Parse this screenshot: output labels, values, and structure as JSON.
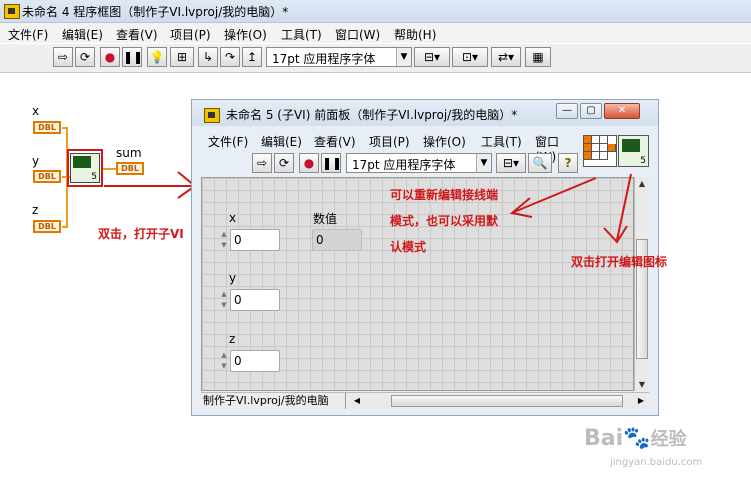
{
  "main_window": {
    "title": "未命名 4 程序框图（制作子VI.lvproj/我的电脑）*",
    "menu": [
      "文件(F)",
      "编辑(E)",
      "查看(V)",
      "项目(P)",
      "操作(O)",
      "工具(T)",
      "窗口(W)",
      "帮助(H)"
    ],
    "toolbar": {
      "font": "17pt 应用程序字体",
      "run_icon": "run-arrow-icon",
      "run_continuous_icon": "run-continuous-icon",
      "abort_icon": "abort-icon",
      "pause_icon": "pause-icon",
      "highlight_icon": "lightbulb-icon",
      "retain_icon": "retain-wire-values-icon",
      "step_into_icon": "step-into-icon",
      "step_over_icon": "step-over-icon",
      "step_out_icon": "step-out-icon",
      "align_icon": "align-objects-icon",
      "distribute_icon": "distribute-objects-icon",
      "reorder_icon": "reorder-icon",
      "cleanup_icon": "clean-up-diagram-icon"
    }
  },
  "diagram": {
    "terminals": [
      {
        "label": "x",
        "type": "DBL"
      },
      {
        "label": "y",
        "type": "DBL"
      },
      {
        "label": "z",
        "type": "DBL"
      }
    ],
    "output": {
      "label": "sum",
      "type": "DBL"
    },
    "subvi_number": "5",
    "annotation_double_click": "双击，打开子VI"
  },
  "sub_window": {
    "title": "未命名 5 (子VI) 前面板（制作子VI.lvproj/我的电脑）*",
    "menu": [
      "文件(F)",
      "编辑(E)",
      "查看(V)",
      "项目(P)",
      "操作(O)",
      "工具(T)",
      "窗口(W)"
    ],
    "font": "17pt 应用程序字体",
    "controls": [
      {
        "label": "x",
        "value": "0"
      },
      {
        "label": "y",
        "value": "0"
      },
      {
        "label": "z",
        "value": "0"
      }
    ],
    "indicator": {
      "label": "数值",
      "value": "0"
    },
    "status_path": "制作子VI.lvproj/我的电脑",
    "subvi_number": "5"
  },
  "annotations": {
    "connector_line1": "可以重新编辑接线端",
    "connector_line2": "模式，也可以采用默",
    "connector_line3": "认模式",
    "icon_edit": "双击打开编辑图标"
  },
  "watermark": {
    "brand": "Bai",
    "brand2": "经验",
    "url": "jingyan.baidu.com"
  },
  "colors": {
    "annotation": "#d11818",
    "dbl_terminal": "#e07800"
  }
}
